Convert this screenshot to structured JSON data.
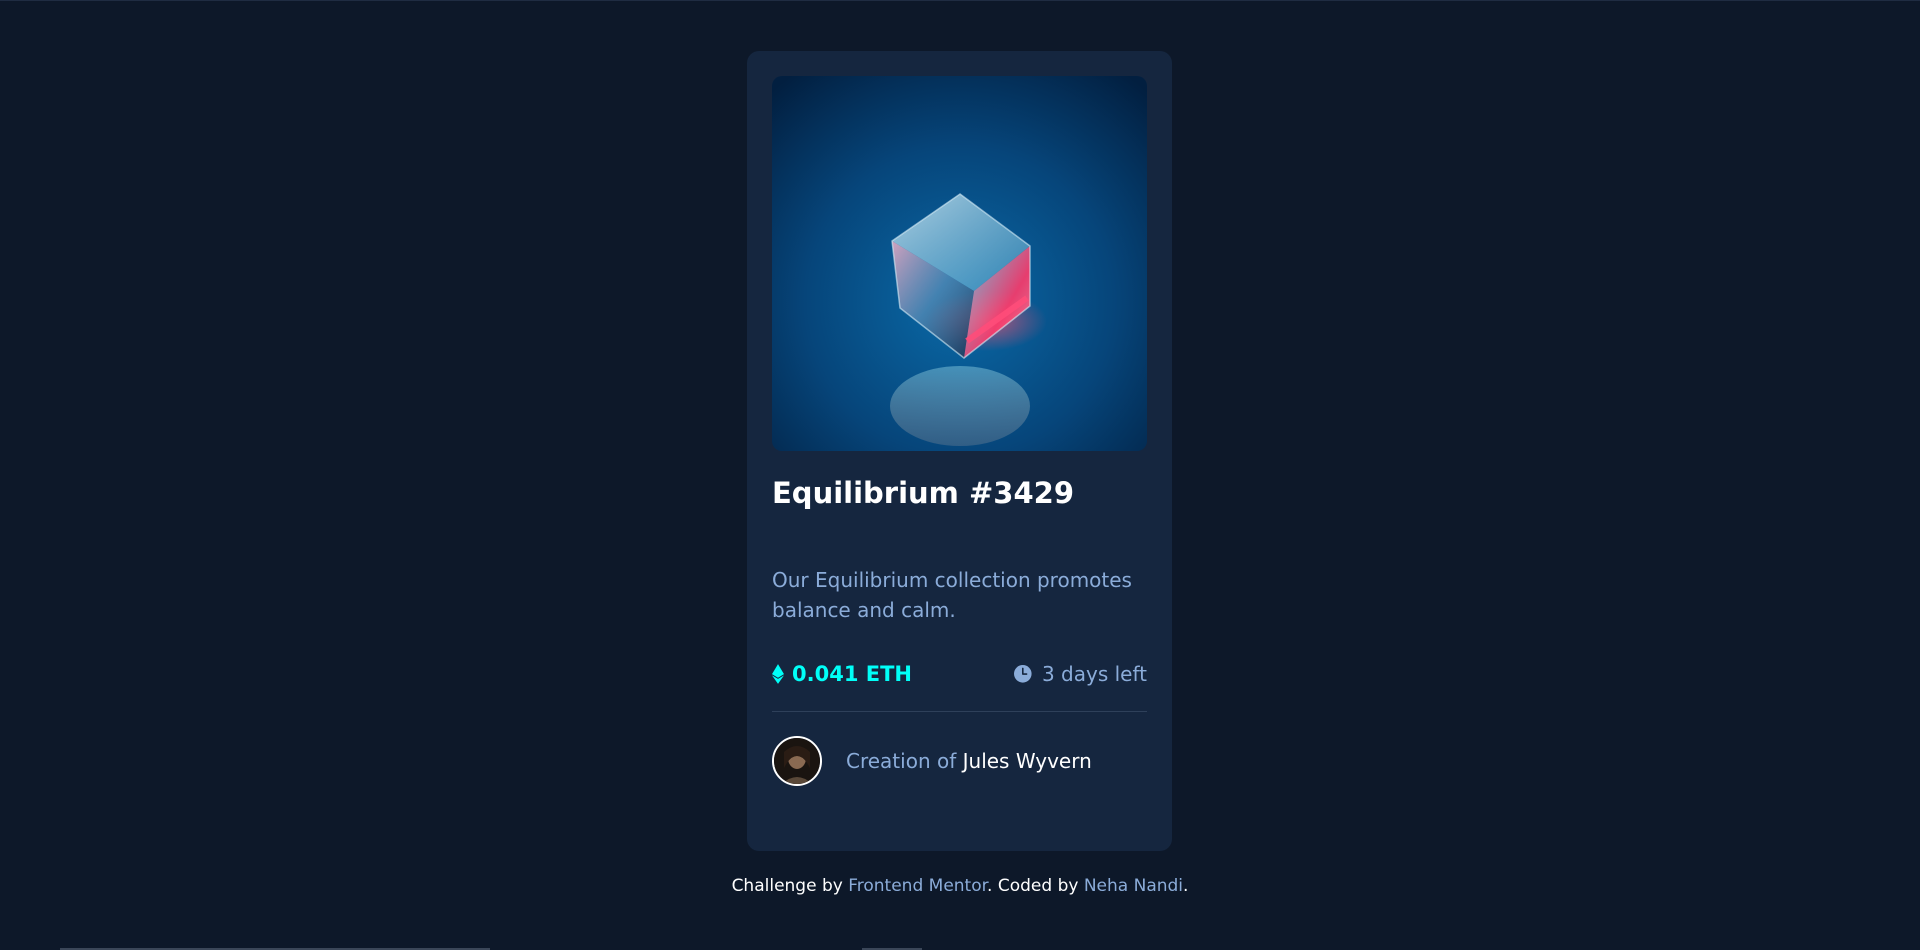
{
  "card": {
    "title": "Equilibrium #3429",
    "description": "Our Equilibrium collection promotes balance and calm.",
    "price": "0.041 ETH",
    "time_left": "3 days left",
    "creator_prefix": "Creation of",
    "creator_name": "Jules Wyvern"
  },
  "footer": {
    "part1": "Challenge by ",
    "link1": "Frontend Mentor",
    "part2": ". Coded by ",
    "link2": "Neha Nandi",
    "part3": "."
  },
  "icons": {
    "price": "ethereum-icon",
    "time": "clock-icon"
  },
  "colors": {
    "background": "#0d1829",
    "card": "#15263f",
    "accent": "#00fff8",
    "soft_blue": "#8bacd9",
    "white": "#ffffff"
  }
}
